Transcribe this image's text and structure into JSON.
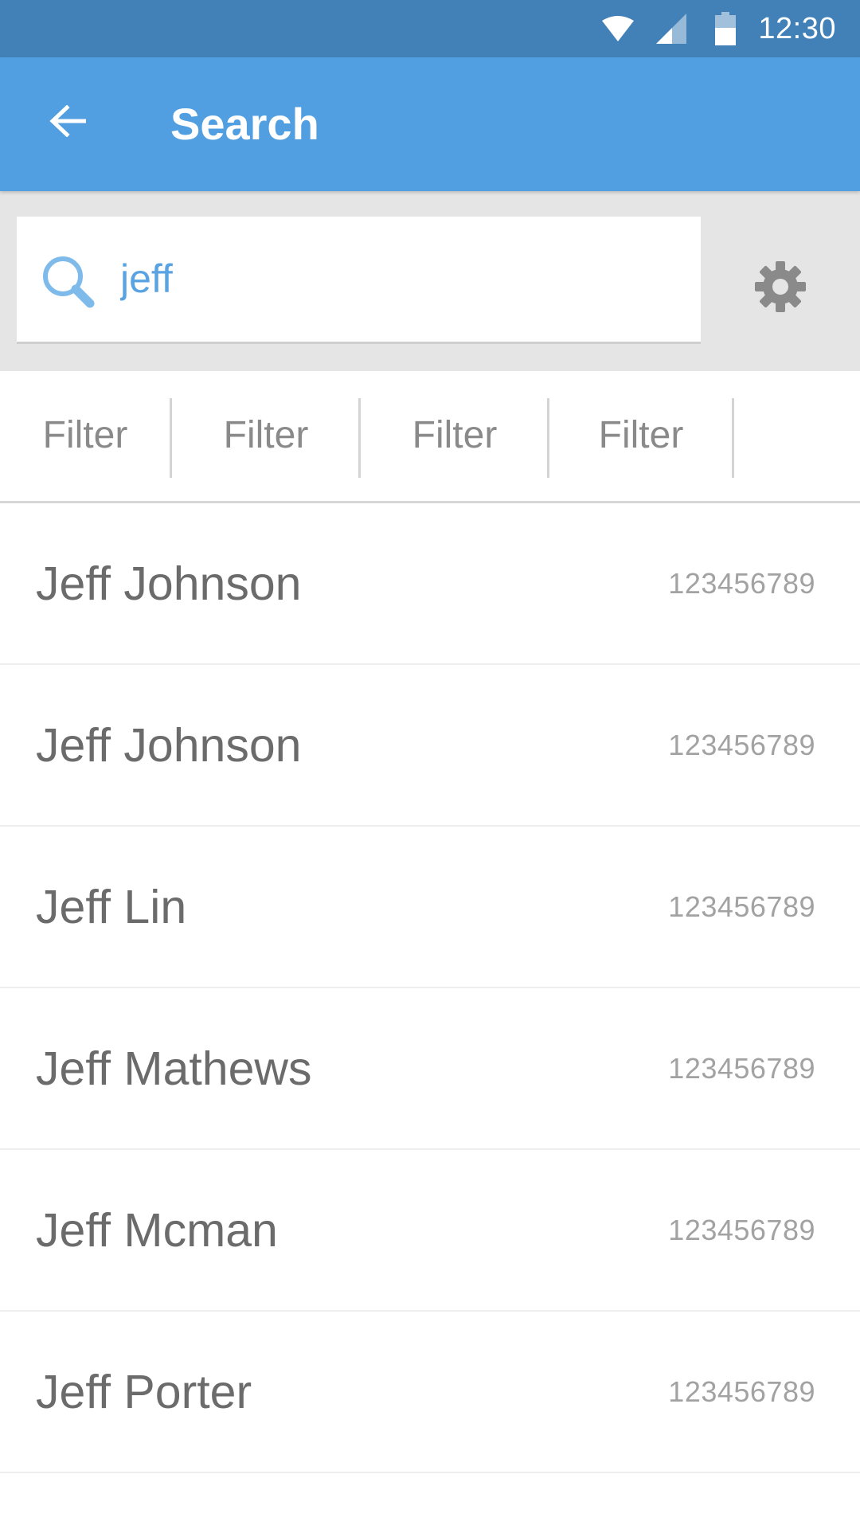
{
  "status_bar": {
    "time": "12:30",
    "icons": [
      "wifi-icon",
      "cell-signal-icon",
      "battery-icon"
    ]
  },
  "app_bar": {
    "title": "Search",
    "back_icon": "arrow-left-icon",
    "background": "#519fe0"
  },
  "search": {
    "value": "jeff",
    "icon": "search-icon",
    "settings_icon": "gear-icon"
  },
  "filters": [
    {
      "label": "Filter"
    },
    {
      "label": "Filter"
    },
    {
      "label": "Filter"
    },
    {
      "label": "Filter"
    }
  ],
  "results": [
    {
      "name": "Jeff Johnson",
      "number": "123456789"
    },
    {
      "name": "Jeff Johnson",
      "number": "123456789"
    },
    {
      "name": "Jeff Lin",
      "number": "123456789"
    },
    {
      "name": "Jeff Mathews",
      "number": "123456789"
    },
    {
      "name": "Jeff Mcman",
      "number": "123456789"
    },
    {
      "name": "Jeff Porter",
      "number": "123456789"
    }
  ],
  "colors": {
    "status_bar": "#4281b8",
    "app_bar": "#519fe0",
    "accent": "#5aa3e2",
    "search_area": "#e5e5e5"
  }
}
